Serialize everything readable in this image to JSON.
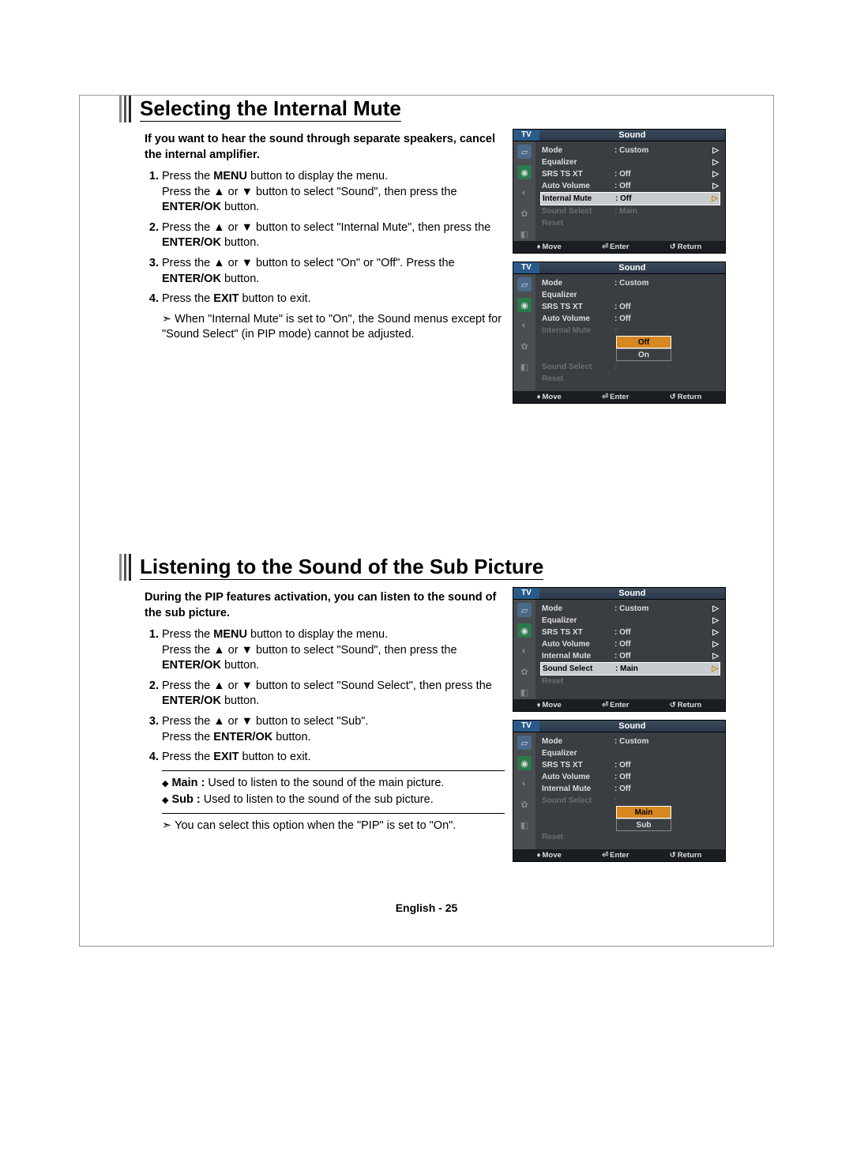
{
  "section1": {
    "title": "Selecting the Internal Mute",
    "intro": "If you want to hear the sound through separate speakers, cancel the internal amplifier.",
    "steps": [
      "Press the MENU button to display the menu. Press the ▲ or ▼ button to select \"Sound\", then press the ENTER/OK button.",
      "Press the ▲ or ▼ button to select \"Internal Mute\", then press the ENTER/OK button.",
      "Press the ▲ or ▼ button to select \"On\" or \"Off\". Press the ENTER/OK button.",
      "Press the EXIT button to exit."
    ],
    "note": "When \"Internal Mute\" is set to \"On\", the Sound menus except for \"Sound Select\" (in PIP mode) cannot be adjusted."
  },
  "section2": {
    "title": "Listening to the Sound of the Sub Picture",
    "intro": "During the PIP features activation, you can listen to the sound of the sub picture.",
    "steps": [
      "Press the MENU button to display the menu. Press the ▲ or ▼ button to select \"Sound\", then press the ENTER/OK button.",
      "Press the ▲ or ▼ button to select \"Sound Select\", then press the ENTER/OK button.",
      "Press the ▲ or ▼ button to select \"Sub\". Press the ENTER/OK button.",
      "Press the EXIT button to exit."
    ],
    "bullets": [
      {
        "label": "Main :",
        "text": " Used to listen to the sound of the main picture."
      },
      {
        "label": "Sub :",
        "text": " Used to listen to the sound of the sub picture."
      }
    ],
    "note": "You can select this option when the \"PIP\" is set to \"On\"."
  },
  "osd": {
    "tv": "TV",
    "title": "Sound",
    "labels": {
      "mode": "Mode",
      "equalizer": "Equalizer",
      "srs": "SRS TS XT",
      "auto": "Auto Volume",
      "mute": "Internal Mute",
      "select": "Sound Select",
      "reset": "Reset"
    },
    "values": {
      "custom": ": Custom",
      "off": ": Off",
      "main": ": Main",
      "colon": ":"
    },
    "options": {
      "off": "Off",
      "on": "On",
      "main": "Main",
      "sub": "Sub"
    },
    "foot": {
      "move": "Move",
      "enter": "Enter",
      "return": "Return"
    }
  },
  "footer": "English - 25"
}
